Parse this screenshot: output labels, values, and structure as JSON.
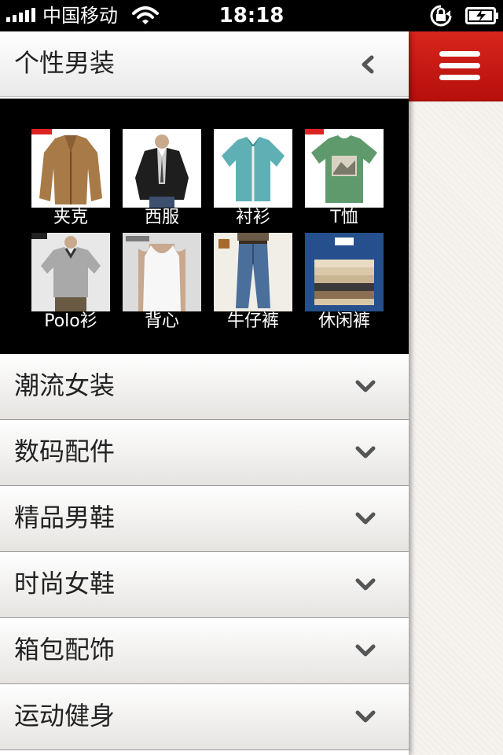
{
  "status_bar": {
    "carrier": "中国移动",
    "time": "18:18"
  },
  "sidebar": {
    "expanded": {
      "title": "个性男装",
      "items": [
        {
          "label": "夹克",
          "icon": "jacket-icon"
        },
        {
          "label": "西服",
          "icon": "suit-icon"
        },
        {
          "label": "衬衫",
          "icon": "shirt-icon"
        },
        {
          "label": "T恤",
          "icon": "tshirt-icon"
        },
        {
          "label": "Polo衫",
          "icon": "polo-icon"
        },
        {
          "label": "背心",
          "icon": "vest-icon"
        },
        {
          "label": "牛仔裤",
          "icon": "jeans-icon"
        },
        {
          "label": "休闲裤",
          "icon": "pants-icon"
        }
      ]
    },
    "categories": [
      {
        "label": "潮流女装"
      },
      {
        "label": "数码配件"
      },
      {
        "label": "精品男鞋"
      },
      {
        "label": "时尚女鞋"
      },
      {
        "label": "箱包配饰"
      },
      {
        "label": "运动健身"
      }
    ]
  },
  "colors": {
    "menu_button": "#c4180f",
    "submenu_bg": "#000000",
    "pane_bg": "#f6f2ee"
  }
}
